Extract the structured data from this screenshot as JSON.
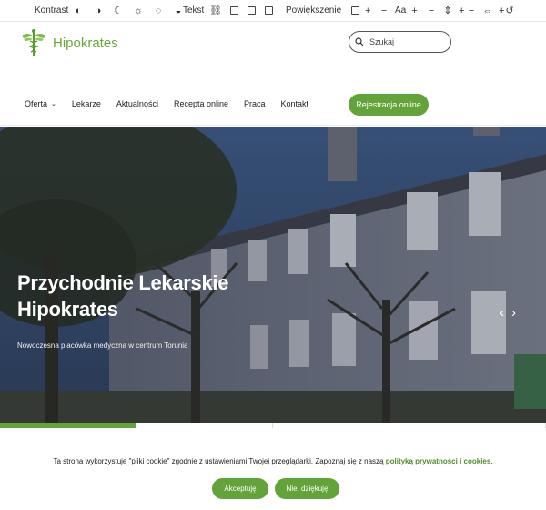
{
  "a11y": {
    "contrast_label": "Kontrast",
    "text_label": "Tekst",
    "zoom_label": "Powiększenie",
    "font_size_label": "Aa",
    "plus": "+"
  },
  "header": {
    "brand": "Hipokrates",
    "search_placeholder": "Szukaj",
    "nav": [
      "Oferta",
      "Lekarze",
      "Aktualności",
      "Recepta online",
      "Praca",
      "Kontakt"
    ],
    "register_button": "Rejestracja online"
  },
  "hero": {
    "title": "Przychodnie Lekarskie Hipokrates",
    "subtitle": "Nowoczesna placówka medyczna w centrum Torunia",
    "prev": "‹",
    "next": "›"
  },
  "cookie": {
    "text_before": "Ta strona wykorzystuje \"pliki cookie\" zgodnie z ustawieniami Twojej przeglądarki. Zapoznaj się z naszą ",
    "link": "polityką prywatności i cookies",
    "text_after": ".",
    "accept": "Akceptuję",
    "decline": "Nie, dziękuję"
  },
  "colors": {
    "brand_green": "#62a33a"
  }
}
